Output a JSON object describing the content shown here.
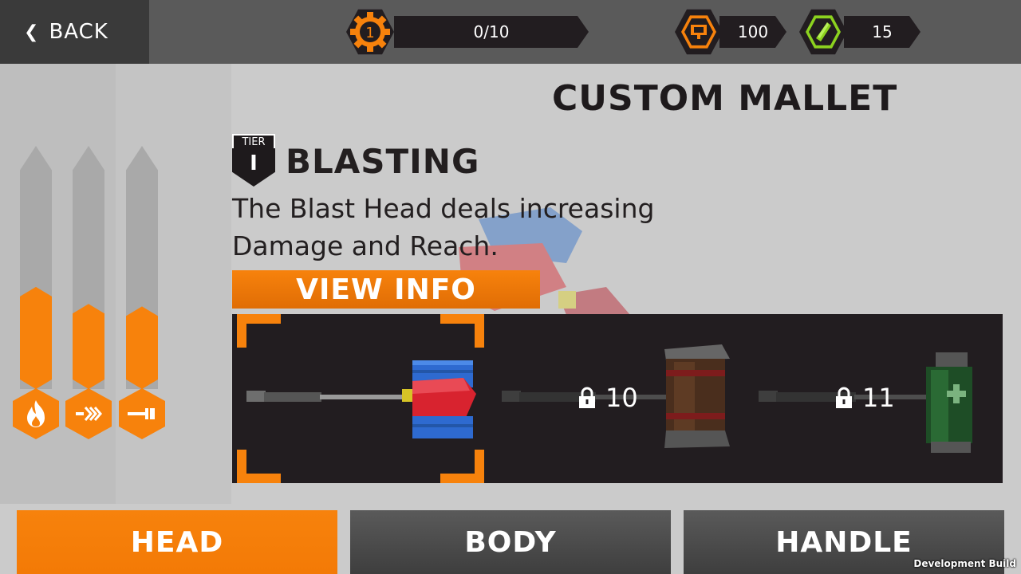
{
  "header": {
    "back_label": "BACK",
    "level_badge": "1",
    "progress_text": "0/10",
    "currency_1": "100",
    "currency_2": "15"
  },
  "stats": {
    "fire_fraction": 0.42,
    "speed_fraction": 0.35,
    "reach_fraction": 0.34,
    "icons": [
      "fire-icon",
      "speed-icon",
      "reach-icon"
    ]
  },
  "main": {
    "title": "CUSTOM MALLET",
    "tier_label": "TIER",
    "tier_value": "I",
    "item_name": "BLASTING",
    "description_line1": "The Blast Head deals increasing",
    "description_line2": "Damage and Reach.",
    "view_info_label": "VIEW INFO"
  },
  "carousel": {
    "items": [
      {
        "name": "Blast Head",
        "locked": false,
        "lock_level": ""
      },
      {
        "name": "Wooden Head",
        "locked": true,
        "lock_level": "10"
      },
      {
        "name": "Medic Head",
        "locked": true,
        "lock_level": "11"
      }
    ]
  },
  "tabs": {
    "head": "HEAD",
    "body": "BODY",
    "handle": "HANDLE"
  },
  "footer": {
    "dev_build": "Development Build"
  },
  "colors": {
    "accent": "#f7820c",
    "dark": "#221d20",
    "topbar": "#5a5a5a",
    "lime": "#8cd21f"
  }
}
